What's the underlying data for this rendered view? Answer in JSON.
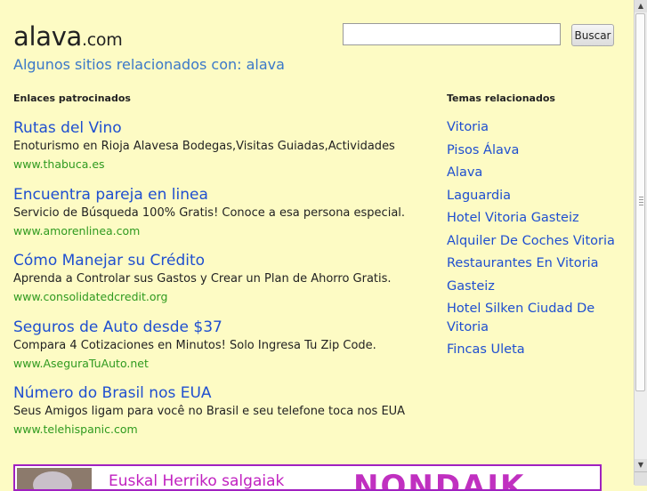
{
  "header": {
    "logo_main": "alava",
    "logo_domain": ".com",
    "subtitle": "Algunos sitios relacionados con: alava"
  },
  "search": {
    "value": "",
    "button_label": "Buscar"
  },
  "sponsored": {
    "heading": "Enlaces patrocinados",
    "ads": [
      {
        "title": "Rutas del Vino",
        "description": "Enoturismo en Rioja Alavesa Bodegas,Visitas Guiadas,Actividades",
        "url": "www.thabuca.es"
      },
      {
        "title": "Encuentra pareja en linea",
        "description": "Servicio de Búsqueda 100% Gratis! Conoce a esa persona especial.",
        "url": "www.amorenlinea.com"
      },
      {
        "title": "Cómo Manejar su Crédito",
        "description": "Aprenda a Controlar sus Gastos y Crear un Plan de Ahorro Gratis.",
        "url": "www.consolidatedcredit.org"
      },
      {
        "title": "Seguros de Auto desde $37",
        "description": "Compara 4 Cotizaciones en Minutos! Solo Ingresa Tu Zip Code.",
        "url": "www.AseguraTuAuto.net"
      },
      {
        "title": "Número do Brasil nos EUA",
        "description": "Seus Amigos ligam para você no Brasil e seu telefone toca nos EUA",
        "url": "www.telehispanic.com"
      }
    ]
  },
  "related": {
    "heading": "Temas relacionados",
    "topics": [
      "Vitoria",
      "Pisos Álava",
      "Alava",
      "Laguardia",
      "Hotel Vitoria Gasteiz",
      "Alquiler De Coches Vitoria",
      "Restaurantes En Vitoria",
      "Gasteiz",
      "Hotel Silken Ciudad De Vitoria",
      "Fincas Uleta"
    ]
  },
  "banner": {
    "title": "Euskal Herriko salgaiak",
    "brand": "NONDAIK"
  }
}
